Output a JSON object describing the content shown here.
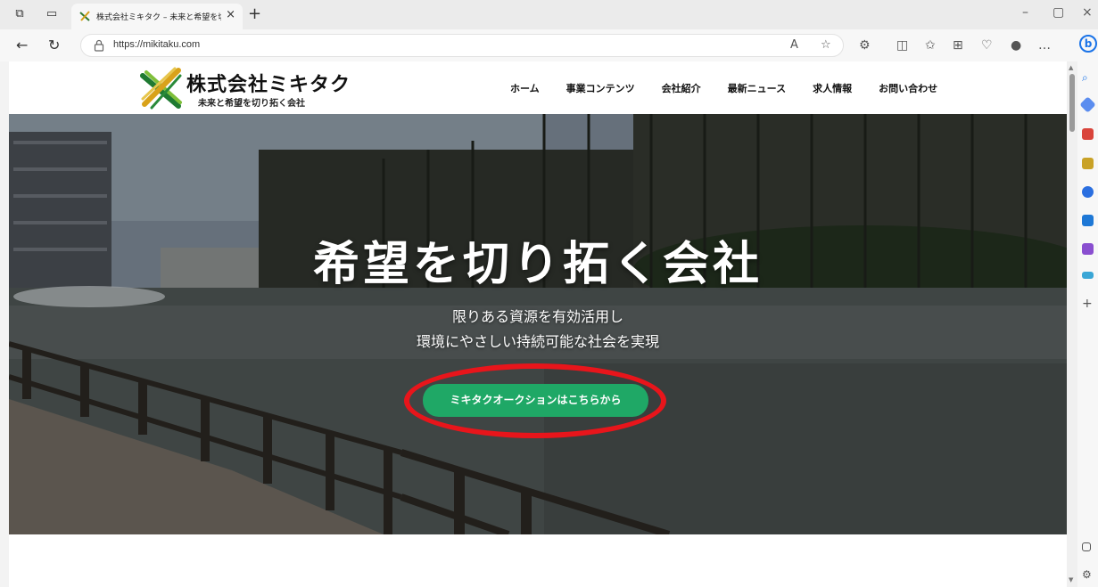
{
  "browser": {
    "tab_title": "株式会社ミキタク – 未来と希望を切",
    "url": "https://mikitaku.com",
    "icons": [
      "workspaces-icon",
      "tab-actions-icon",
      "back-icon",
      "refresh-icon",
      "lock-icon",
      "read-aloud-icon",
      "favorite-icon",
      "extensions-icon",
      "split-screen-icon",
      "favorites-icon",
      "collections-icon",
      "browser-essentials-icon",
      "profile-icon",
      "more-icon",
      "bing-icon"
    ],
    "window_controls": [
      "minimize",
      "restore",
      "close"
    ]
  },
  "site": {
    "logo_name": "株式会社ミキタク",
    "logo_tagline": "未来と希望を切り拓く会社",
    "menu": [
      "ホーム",
      "事業コンテンツ",
      "会社紹介",
      "最新ニュース",
      "求人情報",
      "お問い合わせ"
    ]
  },
  "hero": {
    "title": "希望を切り拓く会社",
    "line1": "限りある資源を有効活用し",
    "line2": "環境にやさしい持続可能な社会を実現",
    "cta_label": "ミキタクオークションはこちらから"
  },
  "colors": {
    "cta": "#1fa866",
    "highlight": "#e8151b"
  }
}
